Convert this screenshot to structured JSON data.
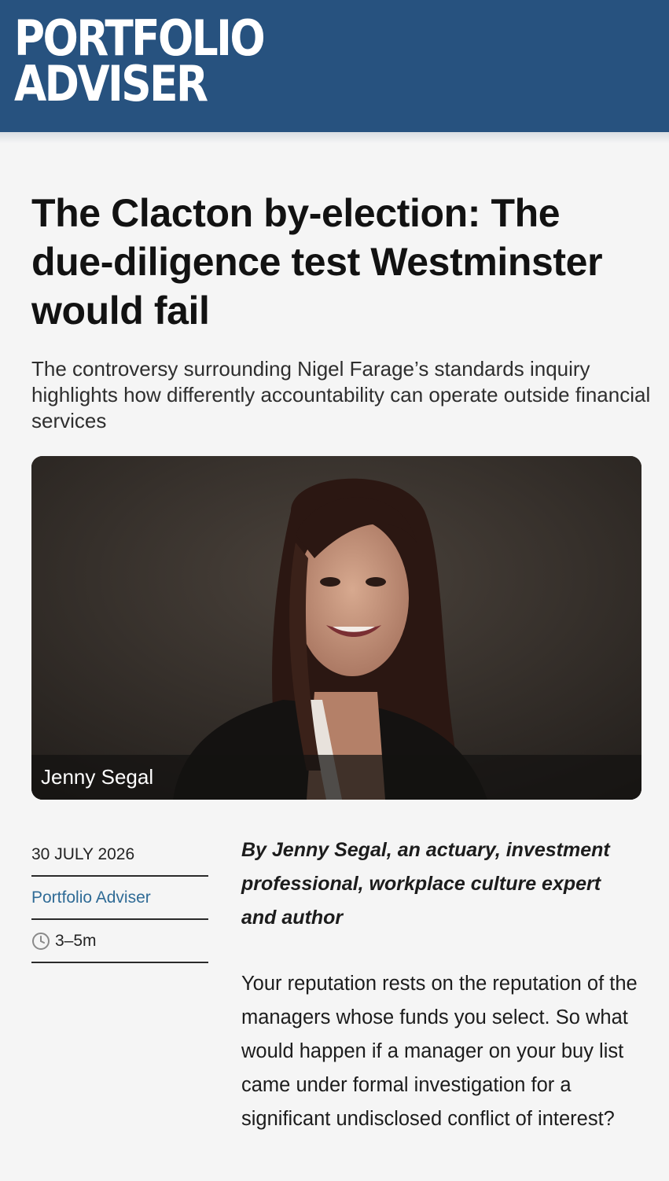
{
  "site": {
    "logo_line1": "PORTFOLIO",
    "logo_line2": "ADVISER",
    "brand_color": "#27527f"
  },
  "article": {
    "headline": "The Clacton by-election: The due-diligence test Westminster would fail",
    "standfirst": "The controversy surrounding Nigel Farage’s standards inquiry highlights how differently accountability can operate outside financial services",
    "image_caption": "Jenny Segal",
    "meta": {
      "date": "30 JULY 2026",
      "publication": "Portfolio Adviser",
      "read_time": "3–5m",
      "read_time_icon": "clock-icon"
    },
    "byline": "By Jenny Segal, an actuary, investment professional, workplace culture expert and author",
    "body_paragraph": "Your reputation rests on the reputation of the managers whose funds you select. So what would happen if a manager on your buy list came under formal investigation for a significant undisclosed conflict of interest?"
  }
}
